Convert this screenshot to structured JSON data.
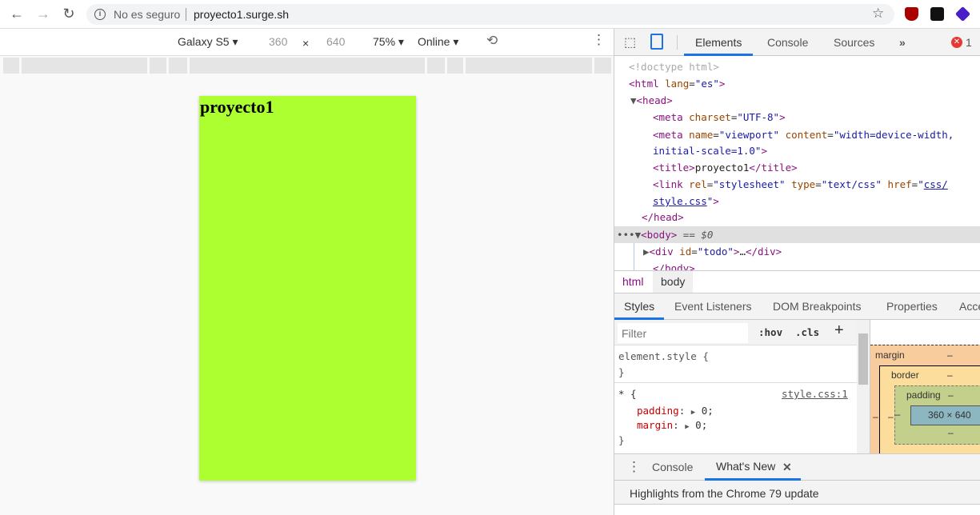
{
  "browser": {
    "security_label": "No es seguro",
    "url": "proyecto1.surge.sh"
  },
  "device_toolbar": {
    "device": "Galaxy S5",
    "width": "360",
    "times": "×",
    "height": "640",
    "zoom": "75%",
    "network": "Online"
  },
  "page": {
    "heading": "proyecto1",
    "background": "#adff2f"
  },
  "devtools": {
    "tabs": [
      "Elements",
      "Console",
      "Sources",
      "»"
    ],
    "error_count": "1",
    "breadcrumbs": [
      "html",
      "body"
    ],
    "style_tabs": [
      "Styles",
      "Event Listeners",
      "DOM Breakpoints",
      "Properties",
      "Acce"
    ],
    "filter_placeholder": "Filter",
    "hov": ":hov",
    "cls": ".cls",
    "plus": "+",
    "element_style": "element.style {",
    "close_brace": "}",
    "rule_selector": "* {",
    "rule_source": "style.css:1",
    "props": [
      {
        "name": "padding",
        "value": "0;"
      },
      {
        "name": "margin",
        "value": "0;"
      }
    ],
    "box": {
      "margin": "margin",
      "border": "border",
      "padding": "padding",
      "dash": "–",
      "content": "360 × 640"
    },
    "drawer_tabs": [
      "Console",
      "What's New"
    ],
    "news": "Highlights from the Chrome 79 update",
    "dom": {
      "doctype": "<!doctype html>",
      "body_marker": "== $0",
      "ellipsis": "…"
    }
  }
}
